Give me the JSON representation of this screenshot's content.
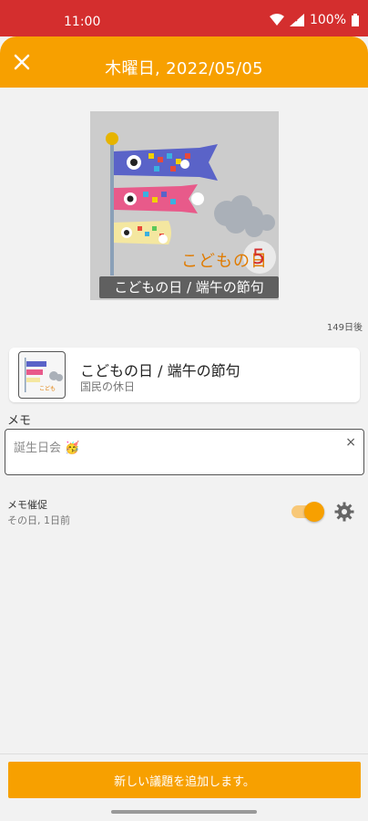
{
  "status_bar": {
    "time": "11:00",
    "battery": "100%"
  },
  "app_bar": {
    "title": "木曜日, 2022/05/05",
    "close_icon": "close-icon"
  },
  "hero": {
    "caption": "こどもの日 / 端午の節句",
    "image_text": "こどもの日",
    "image_number": "5"
  },
  "days_left": "149日後",
  "holiday": {
    "name": "こどもの日 / 端午の節句",
    "type": "国民の休日"
  },
  "memo": {
    "label": "メモ",
    "value": "誕生日会 🥳",
    "clear_icon": "×"
  },
  "reminder": {
    "label": "メモ催促",
    "subtitle": "その日, 1日前",
    "enabled": true
  },
  "actions": {
    "add_button_label": "新しい議題を追加します。"
  },
  "colors": {
    "status_bar": "#d42e2e",
    "accent": "#f7a000"
  }
}
